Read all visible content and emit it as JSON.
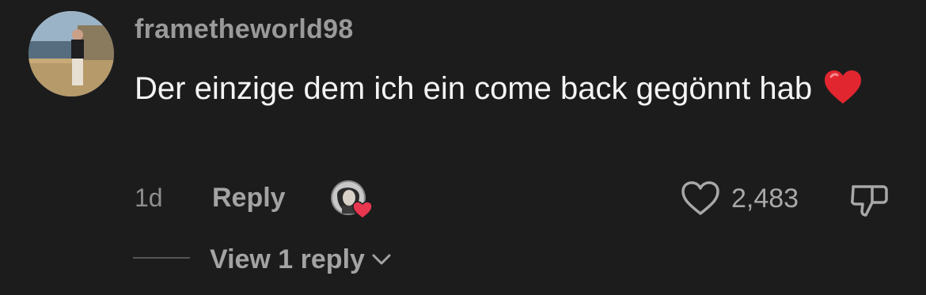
{
  "comment": {
    "username": "frametheworld98",
    "text": "Der einzige dem ich ein come back gegönnt hab",
    "emoji_icon": "red-heart-emoji",
    "time": "1d",
    "reply_label": "Reply",
    "like_count": "2,483",
    "view_replies_label": "View 1 reply"
  },
  "colors": {
    "background": "#1c1c1c",
    "heart_red": "#e8364f"
  }
}
